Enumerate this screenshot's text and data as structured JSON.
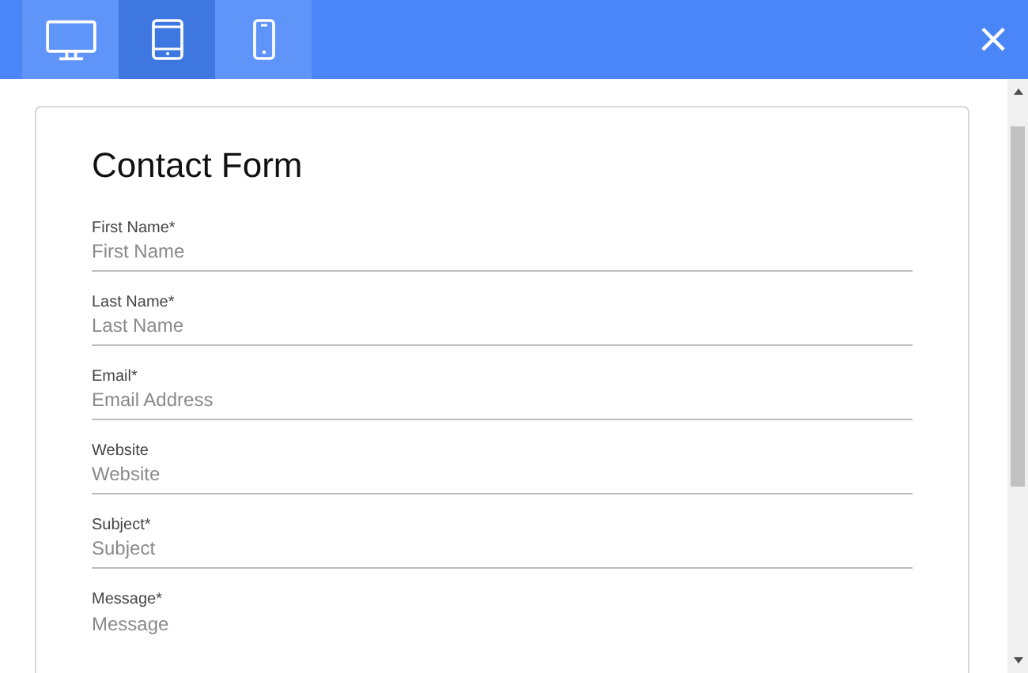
{
  "toolbar": {
    "devices": [
      {
        "kind": "desktop",
        "selected": false
      },
      {
        "kind": "tablet",
        "selected": true
      },
      {
        "kind": "phone",
        "selected": false
      }
    ],
    "close": "×"
  },
  "form": {
    "title": "Contact Form",
    "fields": [
      {
        "kind": "line",
        "label": "First Name*",
        "placeholder": "First Name"
      },
      {
        "kind": "line",
        "label": "Last Name*",
        "placeholder": "Last Name"
      },
      {
        "kind": "line",
        "label": "Email*",
        "placeholder": "Email Address"
      },
      {
        "kind": "line",
        "label": "Website",
        "placeholder": "Website"
      },
      {
        "kind": "line",
        "label": "Subject*",
        "placeholder": "Subject"
      },
      {
        "kind": "area",
        "label": "Message*",
        "placeholder": "Message"
      }
    ]
  }
}
